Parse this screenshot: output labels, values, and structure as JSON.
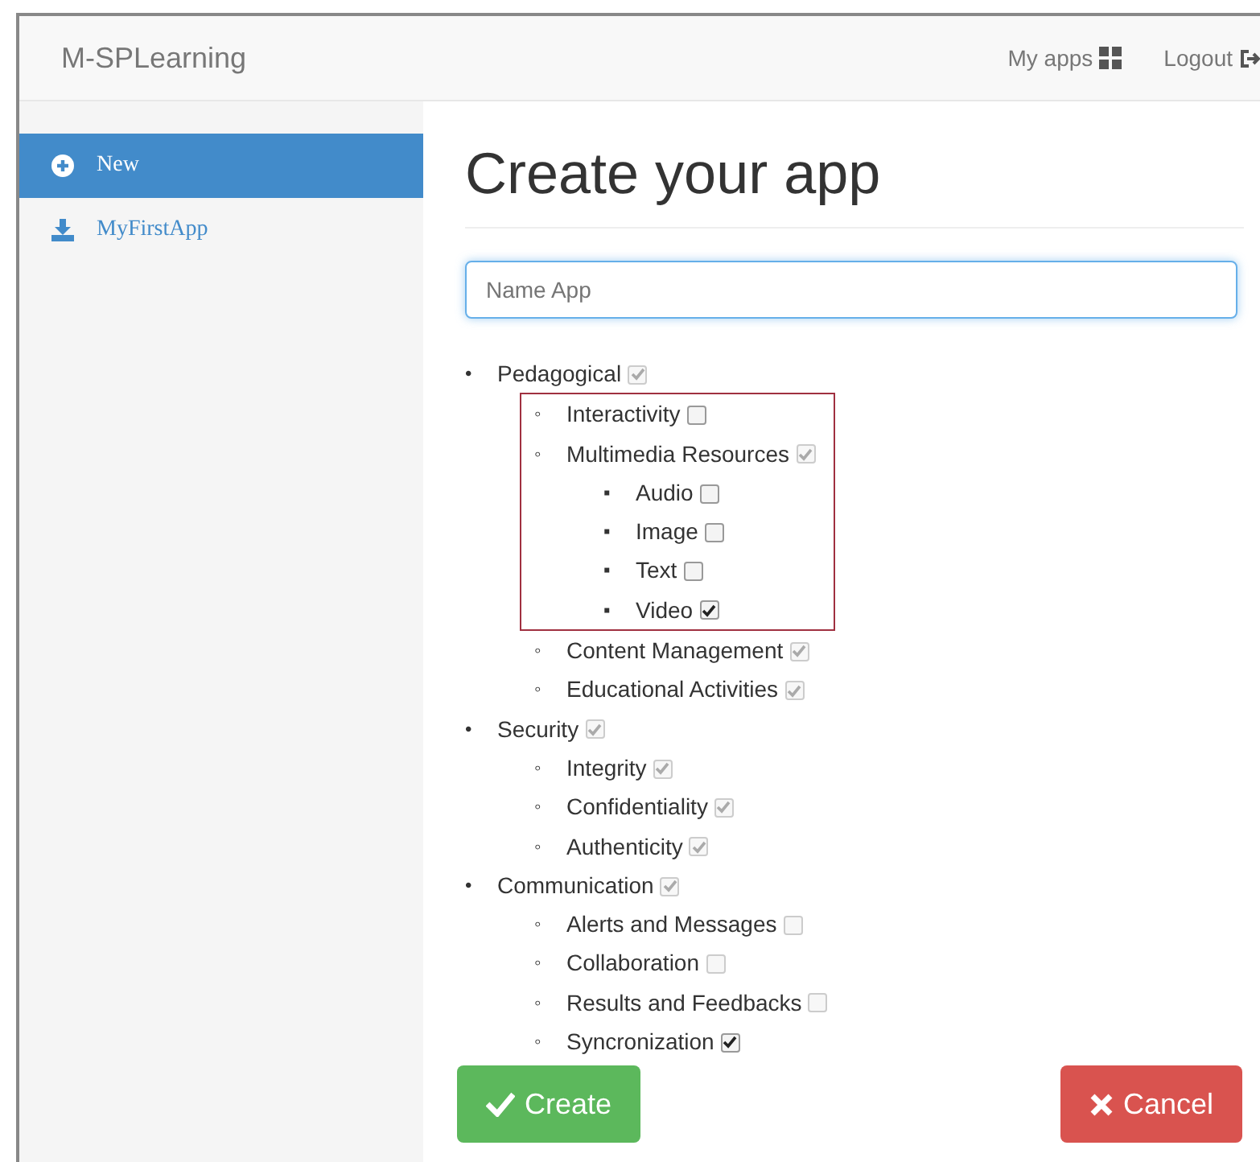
{
  "header": {
    "brand": "M-SPLearning",
    "links": [
      {
        "label": "My apps",
        "kind": "apps"
      },
      {
        "label": "Logout",
        "kind": "logout"
      }
    ]
  },
  "sidebar": {
    "items": [
      {
        "label": "New",
        "kind": "new",
        "selected": true
      },
      {
        "label": "MyFirstApp",
        "kind": "app",
        "selected": false
      }
    ]
  },
  "form": {
    "title": "Create your app",
    "name_field": {
      "placeholder": "Name App"
    },
    "tree": [
      {
        "bullet": "•",
        "label": "Pedagogical",
        "checked": true,
        "disabled": true,
        "highlighted": false,
        "children": [
          {
            "bullet": "◦",
            "label": "Interactivity",
            "checked": false,
            "disabled": false,
            "highlighted": true
          },
          {
            "bullet": "◦",
            "label": "Multimedia Resources",
            "checked": true,
            "disabled": true,
            "highlighted": true,
            "children": [
              {
                "bullet": "▪",
                "label": "Audio",
                "checked": false,
                "disabled": false,
                "highlighted": false
              },
              {
                "bullet": "▪",
                "label": "Image",
                "checked": false,
                "disabled": false,
                "highlighted": false
              },
              {
                "bullet": "▪",
                "label": "Text",
                "checked": false,
                "disabled": false,
                "highlighted": false
              },
              {
                "bullet": "▪",
                "label": "Video",
                "checked": true,
                "disabled": false,
                "highlighted": false
              }
            ]
          },
          {
            "bullet": "◦",
            "label": "Content Management",
            "checked": true,
            "disabled": true,
            "highlighted": false
          },
          {
            "bullet": "◦",
            "label": "Educational Activities",
            "checked": true,
            "disabled": true,
            "highlighted": false
          }
        ]
      },
      {
        "bullet": "•",
        "label": "Security",
        "checked": true,
        "disabled": true,
        "highlighted": false,
        "children": [
          {
            "bullet": "◦",
            "label": "Integrity",
            "checked": true,
            "disabled": true,
            "highlighted": false
          },
          {
            "bullet": "◦",
            "label": "Confidentiality",
            "checked": true,
            "disabled": true,
            "highlighted": false
          },
          {
            "bullet": "◦",
            "label": "Authenticity",
            "checked": true,
            "disabled": true,
            "highlighted": false
          }
        ]
      },
      {
        "bullet": "•",
        "label": "Communication",
        "checked": true,
        "disabled": true,
        "highlighted": false,
        "children": [
          {
            "bullet": "◦",
            "label": "Alerts and Messages",
            "checked": false,
            "disabled": true,
            "highlighted": false
          },
          {
            "bullet": "◦",
            "label": "Collaboration",
            "checked": false,
            "disabled": true,
            "highlighted": false
          },
          {
            "bullet": "◦",
            "label": "Results and Feedbacks",
            "checked": false,
            "disabled": true,
            "highlighted": false
          },
          {
            "bullet": "◦",
            "label": "Syncronization",
            "checked": true,
            "disabled": false,
            "highlighted": false
          }
        ]
      }
    ],
    "buttons": [
      {
        "label": "Create",
        "kind": "create"
      },
      {
        "label": "Cancel",
        "kind": "cancel"
      }
    ]
  }
}
